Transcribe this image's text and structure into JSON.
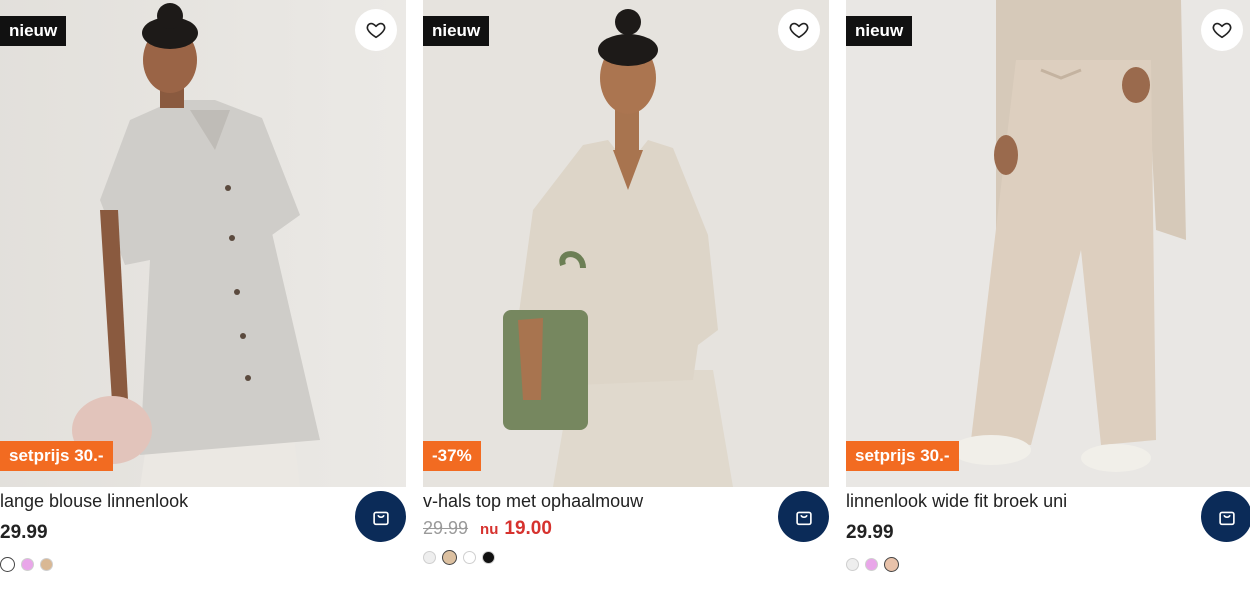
{
  "products": [
    {
      "badge": "nieuw",
      "promo": "setprijs 30.-",
      "title": "lange blouse linnenlook",
      "price": "29.99",
      "swatches": [
        {
          "color": "#ffffff",
          "selected": true
        },
        {
          "color": "#e9a6e9",
          "selected": false
        },
        {
          "color": "#d9b894",
          "selected": false
        }
      ]
    },
    {
      "badge": "nieuw",
      "promo": "-37%",
      "title": "v-hals top met ophaalmouw",
      "old_price": "29.99",
      "now_label": "nu",
      "new_price": "19.00",
      "swatches": [
        {
          "color": "#eeeeee",
          "selected": false
        },
        {
          "color": "#dcc0a0",
          "selected": true
        },
        {
          "color": "#ffffff",
          "selected": false
        },
        {
          "color": "#111111",
          "selected": false
        }
      ]
    },
    {
      "badge": "nieuw",
      "promo": "setprijs 30.-",
      "title": "linnenlook wide fit broek uni",
      "price": "29.99",
      "swatches": [
        {
          "color": "#eeeeee",
          "selected": false
        },
        {
          "color": "#e9a6e9",
          "selected": false
        },
        {
          "color": "#e8c2aa",
          "selected": true
        }
      ]
    }
  ],
  "colors": {
    "accent_navy": "#0b2b58",
    "promo_orange": "#f26b21",
    "sale_red": "#d6322e"
  },
  "icons": {
    "favorite": "heart-icon",
    "cart": "shopping-bag-icon"
  }
}
